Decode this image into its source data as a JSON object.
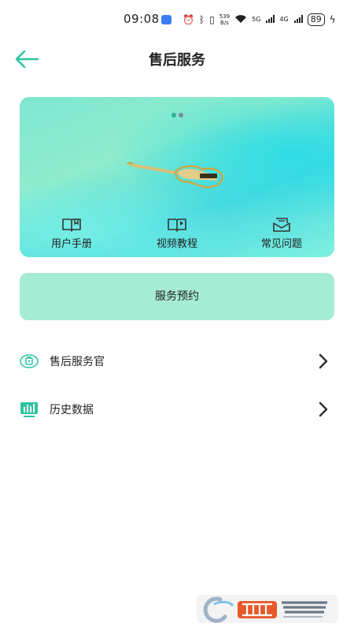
{
  "status_bar": {
    "time": "09:08",
    "net_speed_value": "539",
    "net_speed_unit": "B/s",
    "net_5g": "5G",
    "net_4g": "4G",
    "battery": "89"
  },
  "header": {
    "title": "售后服务",
    "accent_color": "#2ec4a0"
  },
  "banner": {
    "links": [
      {
        "label": "用户手册",
        "icon": "book-icon"
      },
      {
        "label": "视频教程",
        "icon": "book-play-icon"
      },
      {
        "label": "常见问题",
        "icon": "mail-icon"
      }
    ],
    "carousel_pages": 2,
    "carousel_active": 1
  },
  "service_button": {
    "label": "服务预约"
  },
  "list": [
    {
      "label": "售后服务官",
      "icon": "service-officer-icon"
    },
    {
      "label": "历史数据",
      "icon": "history-data-icon"
    }
  ],
  "watermark": {
    "text": "西西软件园",
    "sub": "CR173.COM"
  }
}
